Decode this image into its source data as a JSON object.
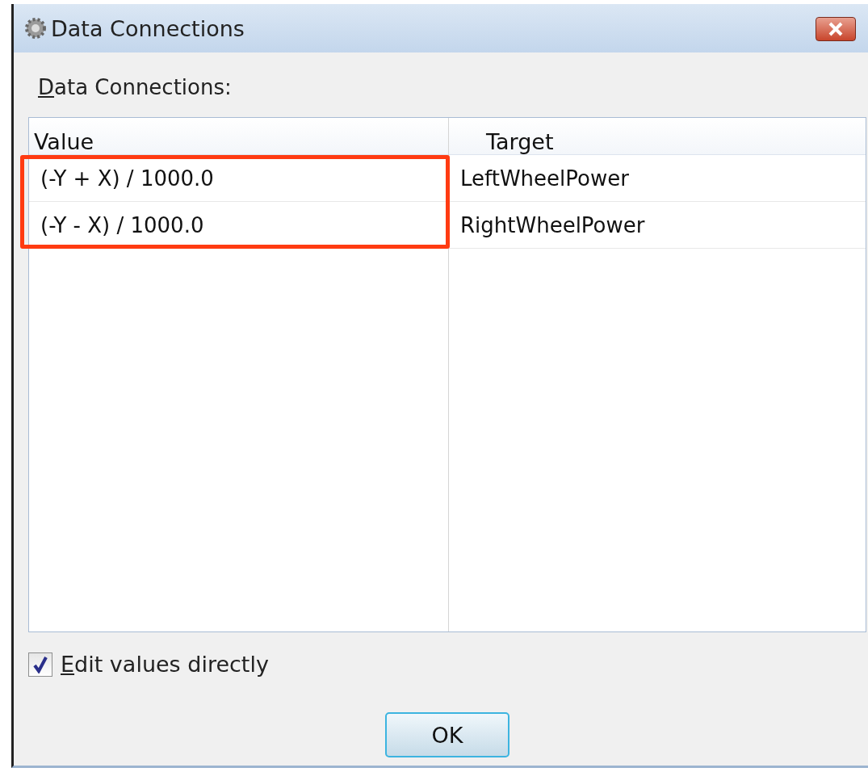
{
  "window": {
    "title": "Data Connections"
  },
  "label": "Data Connections:",
  "table": {
    "columns": [
      "Value",
      "Target"
    ],
    "rows": [
      {
        "value": "(-Y + X) / 1000.0",
        "target": "LeftWheelPower",
        "highlighted": true
      },
      {
        "value": "(-Y - X) / 1000.0",
        "target": "RightWheelPower",
        "highlighted": true
      }
    ]
  },
  "edit_directly": {
    "label": "Edit values directly",
    "checked": true
  },
  "buttons": [
    "OK"
  ]
}
